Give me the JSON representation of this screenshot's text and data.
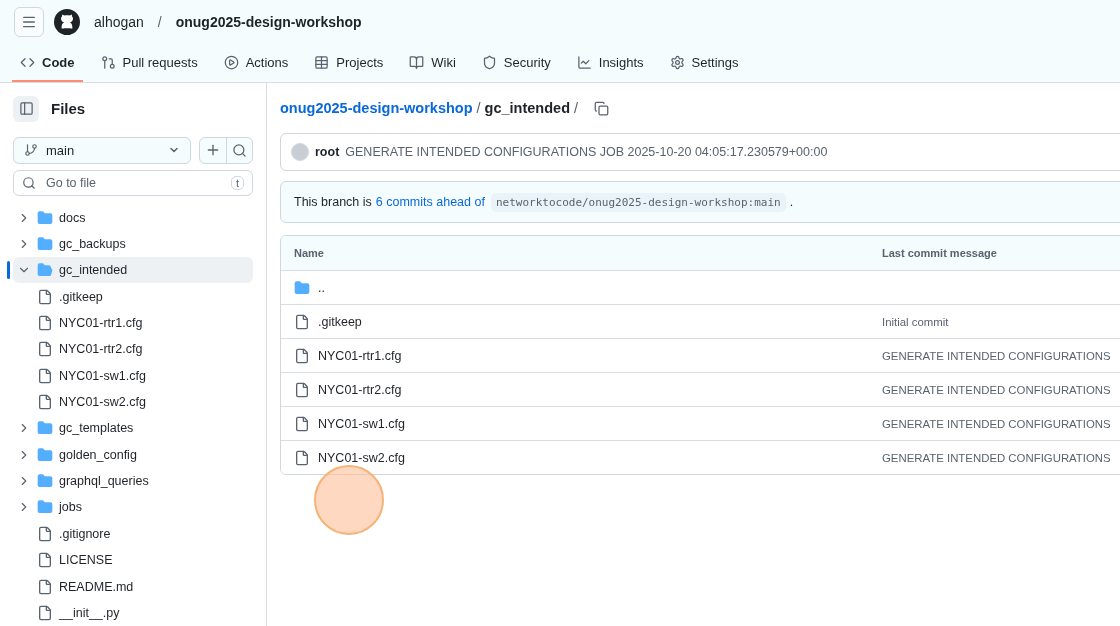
{
  "header": {
    "owner": "alhogan",
    "separator": "/",
    "repo": "onug2025-design-workshop"
  },
  "tabs": [
    {
      "label": "Code",
      "selected": true
    },
    {
      "label": "Pull requests",
      "selected": false
    },
    {
      "label": "Actions",
      "selected": false
    },
    {
      "label": "Projects",
      "selected": false
    },
    {
      "label": "Wiki",
      "selected": false
    },
    {
      "label": "Security",
      "selected": false
    },
    {
      "label": "Insights",
      "selected": false
    },
    {
      "label": "Settings",
      "selected": false
    }
  ],
  "sidebar": {
    "title": "Files",
    "branch": "main",
    "search": {
      "placeholder": "Go to file",
      "shortcut": "t"
    },
    "items": [
      {
        "name": "docs",
        "kind": "folder",
        "expanded": false,
        "selected": false
      },
      {
        "name": "gc_backups",
        "kind": "folder",
        "expanded": false,
        "selected": false
      },
      {
        "name": "gc_intended",
        "kind": "folder",
        "expanded": true,
        "selected": true,
        "children": [
          {
            "name": ".gitkeep",
            "kind": "file",
            "selected": false
          },
          {
            "name": "NYC01-rtr1.cfg",
            "kind": "file",
            "selected": false
          },
          {
            "name": "NYC01-rtr2.cfg",
            "kind": "file",
            "selected": false
          },
          {
            "name": "NYC01-sw1.cfg",
            "kind": "file",
            "selected": false
          },
          {
            "name": "NYC01-sw2.cfg",
            "kind": "file",
            "selected": false
          }
        ]
      },
      {
        "name": "gc_templates",
        "kind": "folder",
        "expanded": false,
        "selected": false
      },
      {
        "name": "golden_config",
        "kind": "folder",
        "expanded": false,
        "selected": false
      },
      {
        "name": "graphql_queries",
        "kind": "folder",
        "expanded": false,
        "selected": false
      },
      {
        "name": "jobs",
        "kind": "folder",
        "expanded": false,
        "selected": false
      },
      {
        "name": ".gitignore",
        "kind": "file",
        "selected": false
      },
      {
        "name": "LICENSE",
        "kind": "file",
        "selected": false
      },
      {
        "name": "README.md",
        "kind": "file",
        "selected": false
      },
      {
        "name": "__init__.py",
        "kind": "file",
        "selected": false
      }
    ]
  },
  "breadcrumb": {
    "repo": "onug2025-design-workshop",
    "separator": "/",
    "folder": "gc_intended",
    "trailing": "/"
  },
  "commit": {
    "author": "root",
    "message": "GENERATE INTENDED CONFIGURATIONS JOB 2025-10-20 04:05:17.230579+00:00"
  },
  "branch_notice": {
    "prefix": "This branch is",
    "link": "6 commits ahead of",
    "ref": "networktocode/onug2025-design-workshop:main",
    "suffix": "."
  },
  "table": {
    "columns": [
      "Name",
      "Last commit message"
    ],
    "rows": [
      {
        "name": "..",
        "kind": "folder",
        "message": ""
      },
      {
        "name": ".gitkeep",
        "kind": "file",
        "message": "Initial commit"
      },
      {
        "name": "NYC01-rtr1.cfg",
        "kind": "file",
        "message": "GENERATE INTENDED CONFIGURATIONS"
      },
      {
        "name": "NYC01-rtr2.cfg",
        "kind": "file",
        "message": "GENERATE INTENDED CONFIGURATIONS"
      },
      {
        "name": "NYC01-sw1.cfg",
        "kind": "file",
        "message": "GENERATE INTENDED CONFIGURATIONS"
      },
      {
        "name": "NYC01-sw2.cfg",
        "kind": "file",
        "message": "GENERATE INTENDED CONFIGURATIONS"
      }
    ]
  }
}
